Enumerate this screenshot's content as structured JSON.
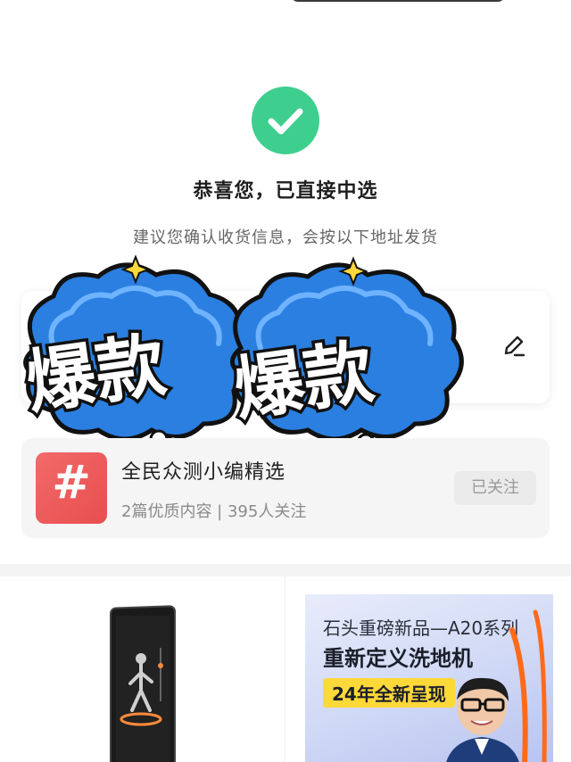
{
  "result": {
    "title": "恭喜您，已直接中选",
    "subtitle": "建议您确认收货信息，会按以下地址发货"
  },
  "sticker": {
    "text_1": "爆款",
    "text_2": "爆款"
  },
  "topic": {
    "thumb_symbol": "#",
    "name": "全民众测小编精选",
    "meta": "2篇优质内容 | 395人关注",
    "follow_label": "已关注"
  },
  "ad": {
    "line1": "石头重磅新品—A20系列",
    "line2": "重新定义洗地机",
    "line3": "24年全新呈现"
  },
  "colors": {
    "success_green": "#3ecf8e",
    "topic_red": "#e84e4e",
    "sticker_blue": "#2a7fe0",
    "ad_yellow": "#ffd83a"
  },
  "icons": {
    "check": "check-icon",
    "edit": "edit-pencil-icon"
  }
}
